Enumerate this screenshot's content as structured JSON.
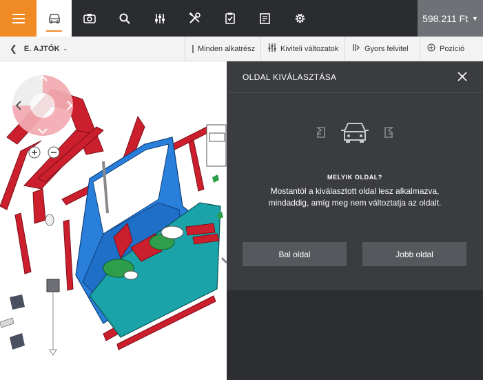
{
  "topbar": {
    "nav_icons": [
      "menu-icon",
      "car-icon",
      "camera-icon",
      "search-icon",
      "sliders-icon",
      "tools-icon",
      "clipboard-check-icon",
      "document-icon",
      "gear-icon"
    ],
    "price": "598.211 Ft"
  },
  "subbar": {
    "breadcrumb": "E. AJTÓK",
    "all_parts_label": "Minden alkatrész",
    "variants_label": "Kiviteli változatok",
    "quick_add_label": "Gyors felvitel",
    "position_label": "Pozíció"
  },
  "panel": {
    "title": "OLDAL KIVÁLASZTÁSA",
    "question_title": "MELYIK OLDAL?",
    "question_text": "Mostantól a kiválasztott oldal lesz alkalmazva, mindaddig, amíg meg nem változtatja az oldalt.",
    "left_button": "Bal oldal",
    "right_button": "Jobb oldal"
  },
  "colors": {
    "accent": "#f08a24",
    "topbar": "#2a2c2f",
    "panel": "#3a3c3f",
    "part_red": "#cc1f2d",
    "part_blue": "#2a7fdb",
    "part_teal": "#1aa3a8",
    "part_green": "#2e9e4a"
  }
}
